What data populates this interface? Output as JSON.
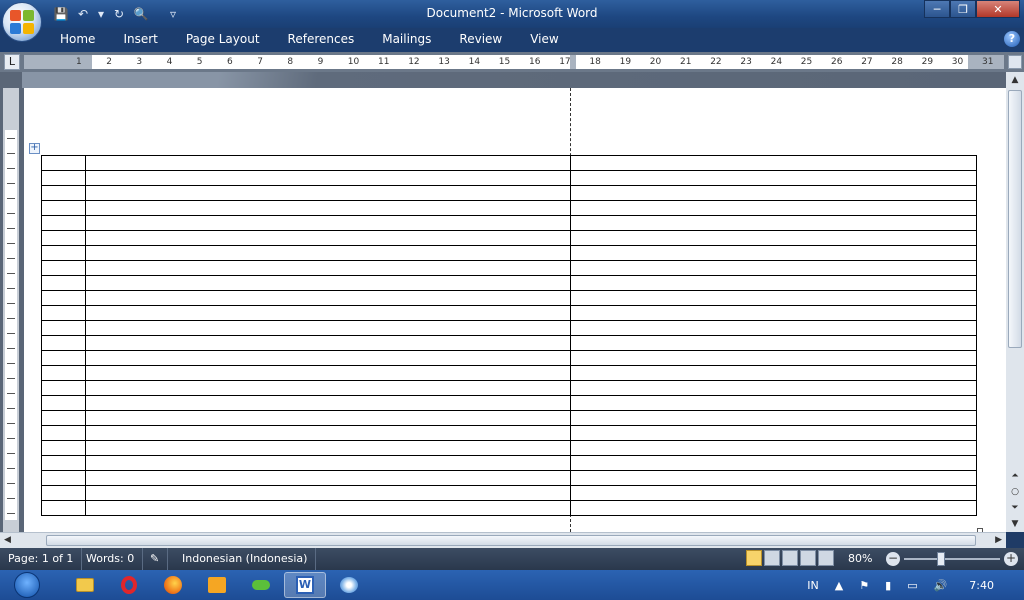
{
  "window": {
    "title": "Document2 - Microsoft Word"
  },
  "quick_access": {
    "save": "💾",
    "undo": "↶",
    "undo_dropdown": "▾",
    "redo": "↻",
    "print_preview": "🔍",
    "customize": "▿"
  },
  "ribbon": {
    "tabs": [
      "Home",
      "Insert",
      "Page Layout",
      "References",
      "Mailings",
      "Review",
      "View"
    ],
    "help": "?"
  },
  "ruler": {
    "tab_selector": "L",
    "numbers": [
      "1",
      "2",
      "3",
      "4",
      "5",
      "6",
      "7",
      "8",
      "9",
      "10",
      "11",
      "12",
      "13",
      "14",
      "15",
      "16",
      "17",
      "18",
      "19",
      "20",
      "21",
      "22",
      "23",
      "24",
      "25",
      "26",
      "27",
      "28",
      "29",
      "30",
      "31"
    ]
  },
  "document": {
    "table": {
      "rows": 24,
      "columns": 3
    }
  },
  "statusbar": {
    "page": "Page: 1 of 1",
    "words": "Words: 0",
    "language": "Indonesian (Indonesia)",
    "zoom": "80%",
    "zoom_minus": "−",
    "zoom_plus": "+",
    "zoom_level_percent": 80
  },
  "taskbar": {
    "apps": [
      "explorer",
      "opera",
      "firefox",
      "media",
      "network",
      "word",
      "paint"
    ],
    "tray": {
      "language": "IN",
      "time": "7:40"
    }
  }
}
